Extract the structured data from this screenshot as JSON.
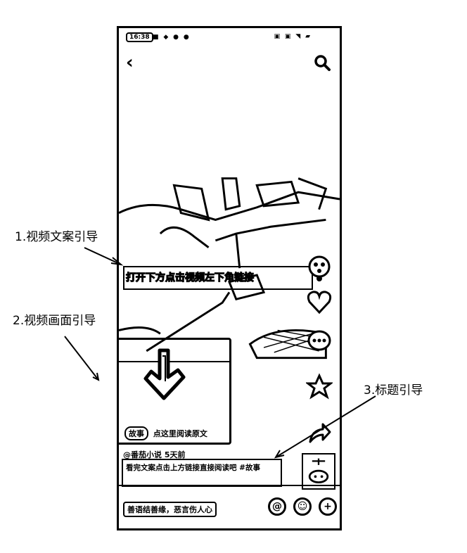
{
  "status_bar": {
    "time": "16:38",
    "left_icons": "■ ◆ ● ●",
    "right_icons": "▣ ▣ ◥ ▰"
  },
  "topbar": {
    "back_icon": "chevron-left-icon",
    "search_icon": "search-icon"
  },
  "video": {
    "caption": "打开下方点击视频左下角链接",
    "tag_chip": "故事",
    "tag_text": "点这里阅读原文"
  },
  "actions": [
    {
      "name": "plus-follow",
      "icon": "+"
    },
    {
      "name": "like",
      "icon": "♡"
    },
    {
      "name": "comment",
      "icon": "•••"
    },
    {
      "name": "favorite",
      "icon": "★"
    },
    {
      "name": "share",
      "icon": "↪"
    }
  ],
  "post": {
    "author": "@番茄小说  5天前",
    "title": "看完文案点击上方链接直接阅读吧 #故事"
  },
  "bottom_bar": {
    "comment_placeholder": "善语结善缘，恶言伤人心",
    "at_icon": "@",
    "emoji_icon": "☺",
    "add_icon": "+"
  },
  "annotations": {
    "label1": "1.视频文案引导",
    "label2": "2.视频画面引导",
    "label3": "3.标题引导"
  }
}
